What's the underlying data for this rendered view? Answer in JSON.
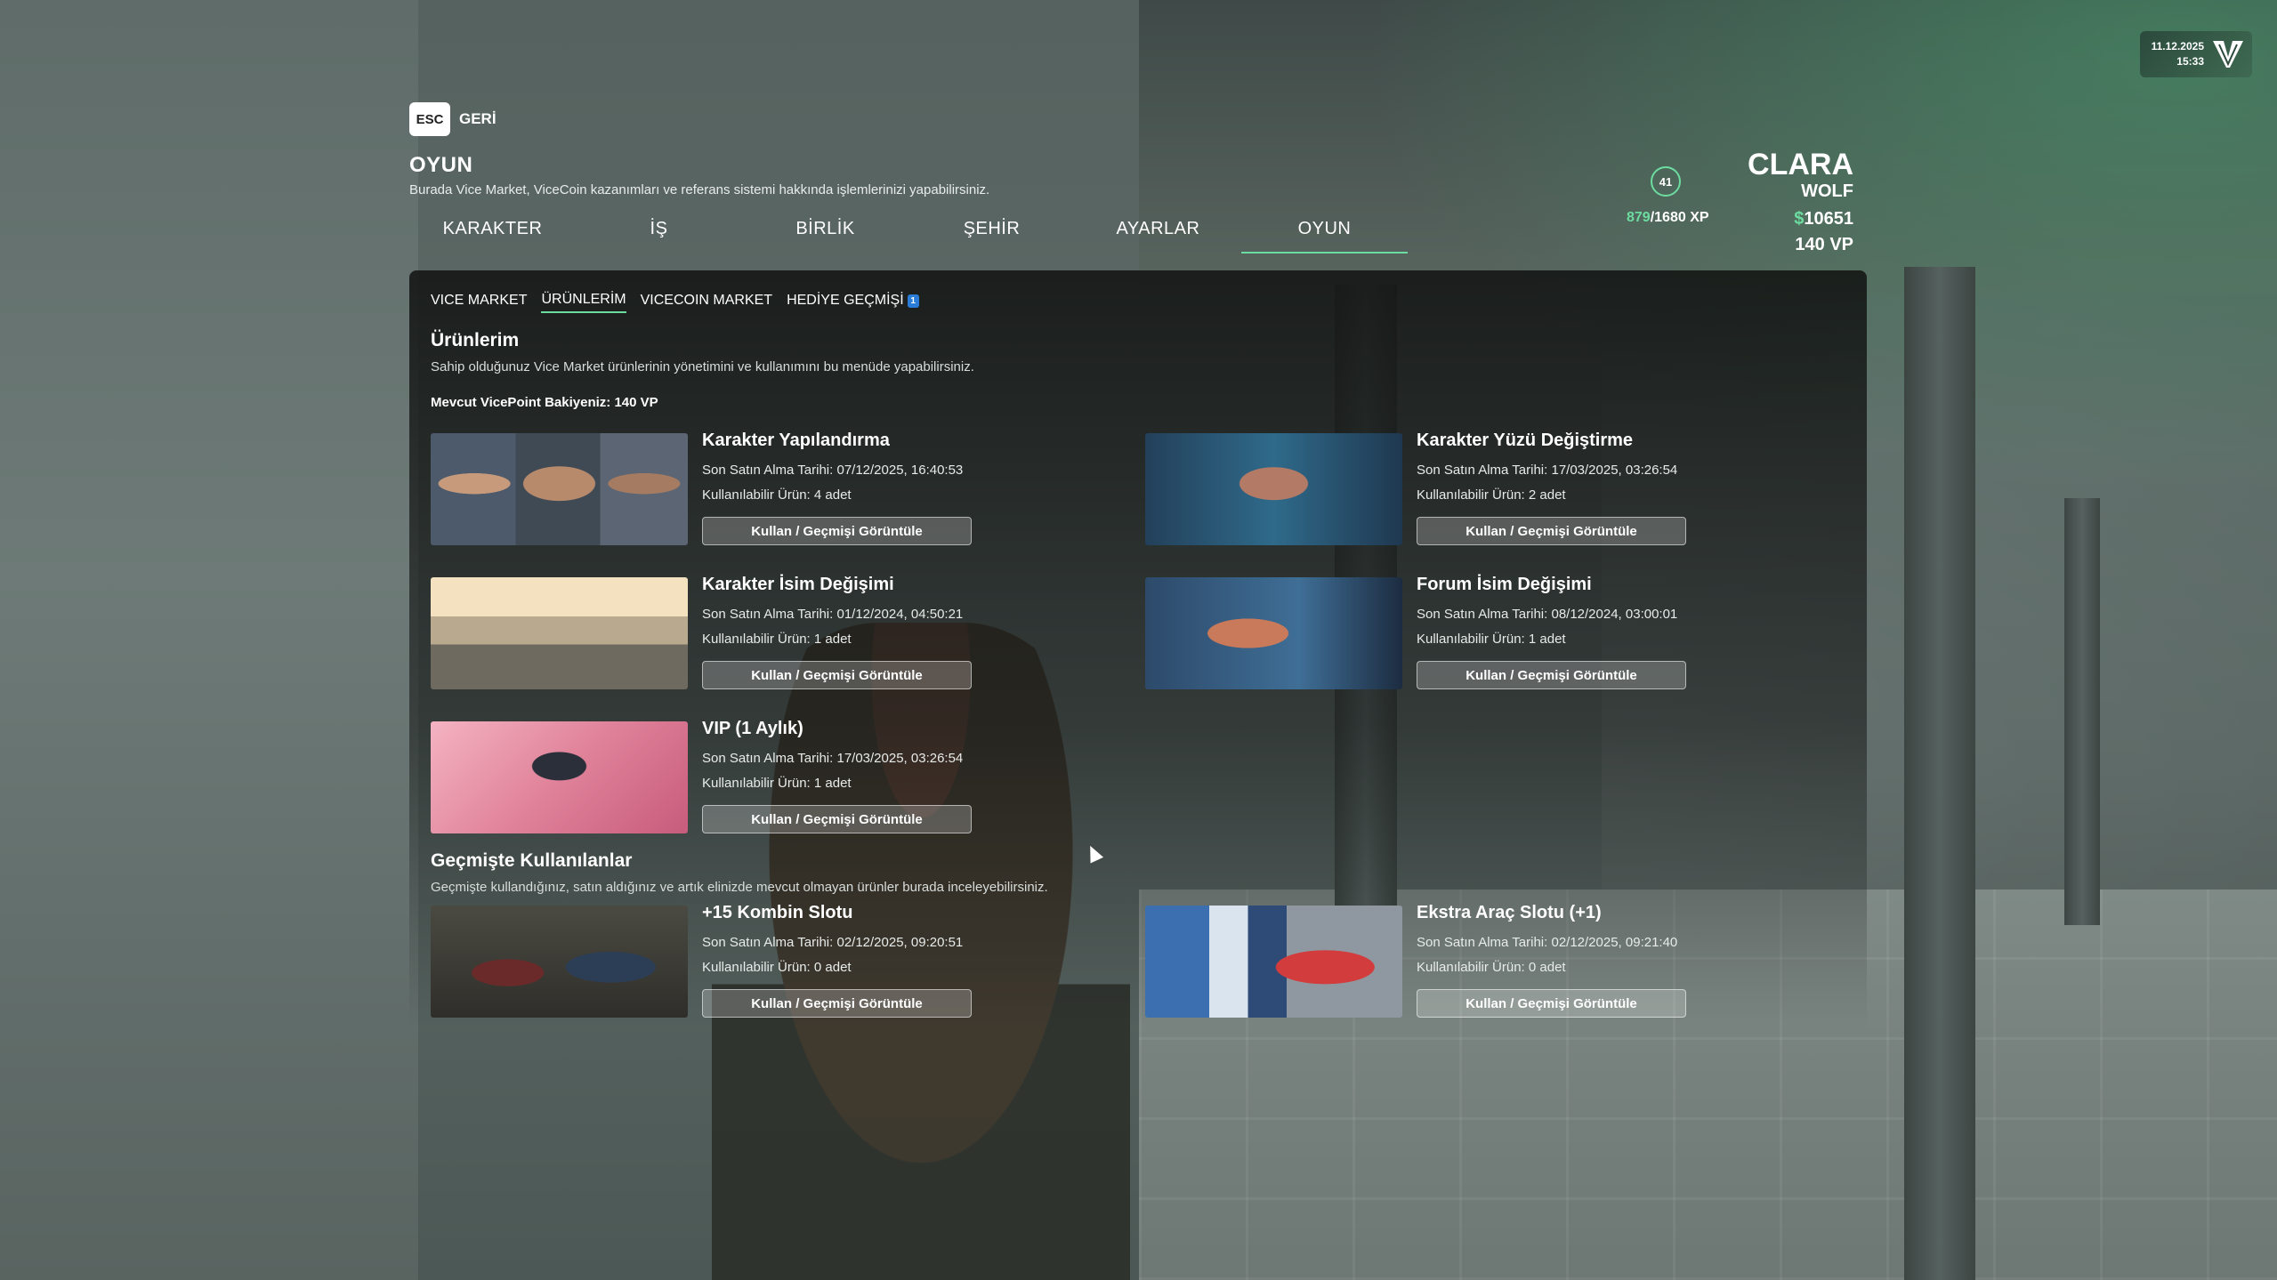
{
  "hud": {
    "date": "11.12.2025",
    "time": "15:33",
    "logo_icon": "v-logo-icon"
  },
  "back": {
    "key": "ESC",
    "label": "GERİ"
  },
  "page": {
    "title": "OYUN",
    "description": "Burada Vice Market, ViceCoin kazanımları ve referans sistemi hakkında işlemlerinizi yapabilirsiniz."
  },
  "nav": {
    "tabs": [
      {
        "label": "KARAKTER"
      },
      {
        "label": "İŞ"
      },
      {
        "label": "BİRLİK"
      },
      {
        "label": "ŞEHİR"
      },
      {
        "label": "AYARLAR"
      },
      {
        "label": "OYUN"
      }
    ],
    "active": "OYUN"
  },
  "player": {
    "level": "41",
    "xp_current": "879",
    "xp_rest": "/1680 XP",
    "first_name": "CLARA",
    "last_name": "WOLF",
    "cash_symbol": "$",
    "cash": "10651",
    "vp": "140 VP"
  },
  "subnav": {
    "tabs": [
      {
        "label": "VICE MARKET"
      },
      {
        "label": "ÜRÜNLERİM"
      },
      {
        "label": "VICECOIN MARKET"
      },
      {
        "label": "HEDİYE GEÇMİŞİ",
        "badge": "1"
      }
    ],
    "active": "ÜRÜNLERİM"
  },
  "products": {
    "title": "Ürünlerim",
    "description": "Sahip olduğunuz Vice Market ürünlerinin yönetimini ve kullanımını bu menüde yapabilirsiniz.",
    "balance": "Mevcut VicePoint Bakiyeniz: 140 VP",
    "items": [
      {
        "name": "Karakter Yapılandırma",
        "date": "Son Satın Alma Tarihi: 07/12/2025, 16:40:53",
        "qty": "Kullanılabilir Ürün: 4 adet",
        "button": "Kullan / Geçmişi Görüntüle"
      },
      {
        "name": "Karakter Yüzü Değiştirme",
        "date": "Son Satın Alma Tarihi: 17/03/2025, 03:26:54",
        "qty": "Kullanılabilir Ürün: 2 adet",
        "button": "Kullan / Geçmişi Görüntüle"
      },
      {
        "name": "Karakter İsim Değişimi",
        "date": "Son Satın Alma Tarihi: 01/12/2024, 04:50:21",
        "qty": "Kullanılabilir Ürün: 1 adet",
        "button": "Kullan / Geçmişi Görüntüle"
      },
      {
        "name": "Forum İsim Değişimi",
        "date": "Son Satın Alma Tarihi: 08/12/2024, 03:00:01",
        "qty": "Kullanılabilir Ürün: 1 adet",
        "button": "Kullan / Geçmişi Görüntüle"
      },
      {
        "name": "VIP (1 Aylık)",
        "date": "Son Satın Alma Tarihi: 17/03/2025, 03:26:54",
        "qty": "Kullanılabilir Ürün: 1 adet",
        "button": "Kullan / Geçmişi Görüntüle"
      }
    ]
  },
  "history": {
    "title": "Geçmişte Kullanılanlar",
    "description": "Geçmişte kullandığınız, satın aldığınız ve artık elinizde mevcut olmayan ürünler burada inceleyebilirsiniz.",
    "items": [
      {
        "name": "+15 Kombin Slotu",
        "date": "Son Satın Alma Tarihi: 02/12/2025, 09:20:51",
        "qty": "Kullanılabilir Ürün: 0 adet",
        "button": "Kullan / Geçmişi Görüntüle"
      },
      {
        "name": "Ekstra Araç Slotu (+1)",
        "date": "Son Satın Alma Tarihi: 02/12/2025, 09:21:40",
        "qty": "Kullanılabilir Ürün: 0 adet",
        "button": "Kullan / Geçmişi Görüntüle"
      }
    ]
  }
}
